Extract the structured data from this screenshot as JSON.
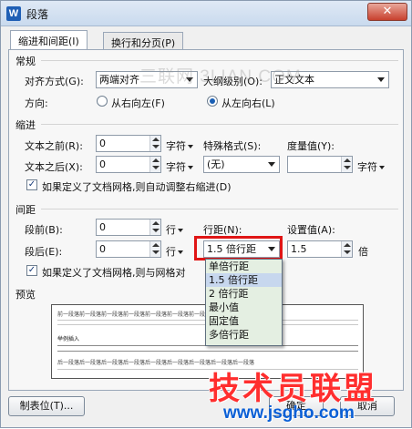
{
  "window": {
    "app_icon": "W",
    "title": "段落",
    "close_label": "✕"
  },
  "tabs": [
    {
      "label": "缩进和间距(I)",
      "active": true
    },
    {
      "label": "换行和分页(P)",
      "active": false
    }
  ],
  "general": {
    "section": "常规",
    "align_label": "对齐方式(G):",
    "align_value": "两端对齐",
    "outline_label": "大纲级别(O):",
    "outline_value": "正文文本",
    "direction_label": "方向:",
    "rtl_label": "从右向左(F)",
    "ltr_label": "从左向右(L)",
    "direction_selected": "ltr"
  },
  "indent": {
    "section": "缩进",
    "before_label": "文本之前(R):",
    "before_value": "0",
    "before_unit": "字符",
    "after_label": "文本之后(X):",
    "after_value": "0",
    "after_unit": "字符",
    "special_label": "特殊格式(S):",
    "special_value": "(无)",
    "measure_label": "度量值(Y):",
    "measure_value": "",
    "measure_unit": "字符",
    "grid_check_label": "如果定义了文档网格,则自动调整右缩进(D)",
    "grid_checked": true
  },
  "spacing": {
    "section": "间距",
    "before_label": "段前(B):",
    "before_value": "0",
    "before_unit": "行",
    "after_label": "段后(E):",
    "after_value": "0",
    "after_unit": "行",
    "line_label": "行距(N):",
    "line_value": "1.5 倍行距",
    "setting_label": "设置值(A):",
    "setting_value": "1.5",
    "setting_unit": "倍",
    "grid_check_label": "如果定义了文档网格,则与网格对",
    "grid_checked": true
  },
  "line_spacing_options": [
    "单倍行距",
    "1.5 倍行距",
    "2 倍行距",
    "最小值",
    "固定值",
    "多倍行距"
  ],
  "line_spacing_selected_index": 1,
  "preview": {
    "section": "预览",
    "line_text": "前一段落前一段落前一段落前一段落前一段落前一段落前一段落前一段落前一段落",
    "sample_text": "举例插入",
    "after_text": "后一段落后一段落后一段落后一段落后一段落后一段落后一段落后一段落后一段落"
  },
  "buttons": {
    "tabs": "制表位(T)...",
    "ok": "确定",
    "cancel": "取消"
  },
  "watermarks": {
    "site_top": "三联网 3LIAN.COM",
    "logo_cn": "技术员联盟",
    "logo_url": "www.jsgho.com"
  },
  "colors": {
    "highlight": "#e01515",
    "dropdown_bg": "#e4efe2",
    "logo_red": "#ff2e2e",
    "logo_blue": "#0a5fd6"
  }
}
